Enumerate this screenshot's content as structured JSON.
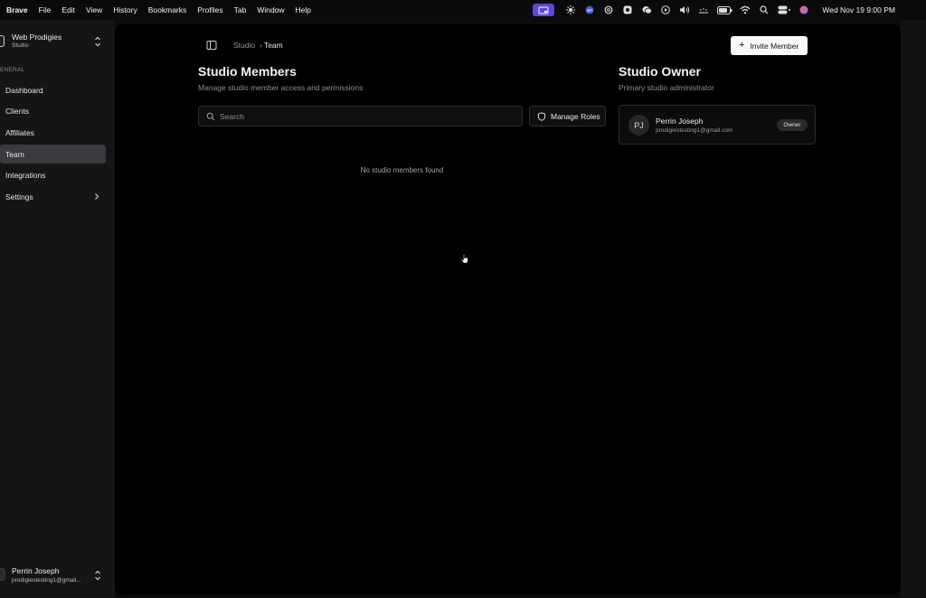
{
  "menubar": {
    "app": "Brave",
    "items": [
      "File",
      "Edit",
      "View",
      "History",
      "Bookmarks",
      "Profiles",
      "Tab",
      "Window",
      "Help"
    ],
    "clock": "Wed Nov 19  9:00 PM",
    "status_icons": [
      "screen-record-icon",
      "sparkle-icon",
      "extension-icon",
      "chatgpt-icon",
      "app-icon",
      "wechat-icon",
      "play-icon",
      "volume-icon",
      "dots-icon",
      "battery-icon",
      "wifi-icon",
      "search-icon",
      "control-center-icon",
      "siri-icon"
    ]
  },
  "sidebar": {
    "workspace": {
      "name": "Web Prodigies",
      "type": "Studio"
    },
    "section_label": "ENERAL",
    "items": [
      {
        "label": "Dashboard",
        "active": false
      },
      {
        "label": "Clients",
        "active": false
      },
      {
        "label": "Affiliates",
        "active": false
      },
      {
        "label": "Team",
        "active": true
      },
      {
        "label": "Integrations",
        "active": false
      },
      {
        "label": "Settings",
        "active": false
      }
    ],
    "user": {
      "name": "Perrin Joseph",
      "email": "prodigiestesting1@gmail..."
    }
  },
  "main": {
    "breadcrumb": {
      "parent": "Studio",
      "current": "Team"
    },
    "invite_label": "Invite Member",
    "members": {
      "title": "Studio Members",
      "subtitle": "Manage studio member access and permissions",
      "search_placeholder": "Search",
      "manage_roles_label": "Manage Roles",
      "empty_text": "No studio members found"
    },
    "owner": {
      "title": "Studio Owner",
      "subtitle": "Primary studio administrator",
      "initials": "PJ",
      "name": "Perrin Joseph",
      "email": "prodigiestesting1@gmail.com",
      "badge": "Owner"
    }
  },
  "colors": {
    "accent_pill": "#5a4ad6",
    "background": "#000000",
    "sidebar": "#151517",
    "active_item": "#3a3a3e"
  }
}
